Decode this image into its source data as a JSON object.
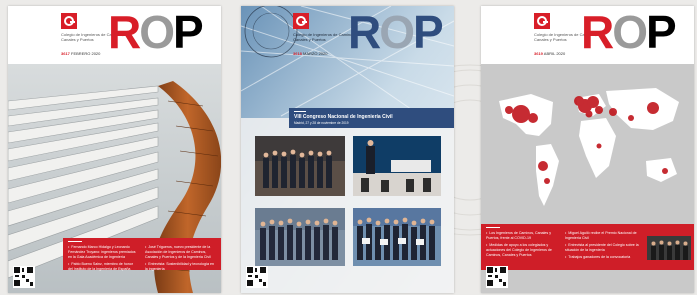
{
  "covers": [
    {
      "publisher": "Colegio de Ingenieros de Caminos, Canales y Puertos",
      "issue_number": "3617",
      "issue_date": "FEBRERO 2020",
      "title_letters": [
        "R",
        "O",
        "P"
      ],
      "theme": "bridge-walkway-photo",
      "panel_items_left": [
        "Fernando Marco Hidalgo y Leonardo Fernández Troyano: ingenieros premiados en la Gala Académica de Ingeniería",
        "Pablo Bueno Sainz, miembro de honor del Instituto de la Ingeniería de España"
      ],
      "panel_items_right": [
        "José Trigueros, nuevo presidente de la Asociación de Ingenieros de Caminos, Canales y Puertos y de la Ingeniería Civil",
        "Entrevista: Sostenibilidad y tecnología en la ingeniería"
      ]
    },
    {
      "publisher": "Colegio de Ingenieros de Caminos, Canales y Puertos",
      "issue_number": "3618",
      "issue_date": "MARZO 2020",
      "title_letters": [
        "R",
        "O",
        "P"
      ],
      "theme": "congress-photo-grid",
      "banner_title": "VIII Congreso Nacional de Ingeniería Civil",
      "banner_sub": "Madrid, 27 y 28 de noviembre de 2019"
    },
    {
      "publisher": "Colegio de Ingenieros de Caminos, Canales y Puertos",
      "issue_number": "3619",
      "issue_date": "ABRIL 2020",
      "title_letters": [
        "R",
        "O",
        "P"
      ],
      "theme": "covid-world-map",
      "panel_items_left": [
        "Los Ingenieros de Caminos, Canales y Puertos, frente al COVID-19",
        "Medidas de apoyo a los colegiados y actuaciones del Colegio de Ingenieros de Caminos, Canales y Puertos"
      ],
      "panel_items_right": [
        "Miguel Aguiló recibe el Premio Nacional de Ingeniería Civil",
        "Entrevista al presidente del Colegio sobre la situación de la ingeniería",
        "Trabajos ganadores de la convocatoria"
      ]
    }
  ],
  "colors": {
    "accent_red": "#d81e28",
    "banner_blue": "#2f4d7e",
    "map_grey": "#c9c9c9",
    "page_bg": "#ecebe9"
  },
  "icons": [
    "qr-code-icon",
    "colegio-logo-icon"
  ]
}
